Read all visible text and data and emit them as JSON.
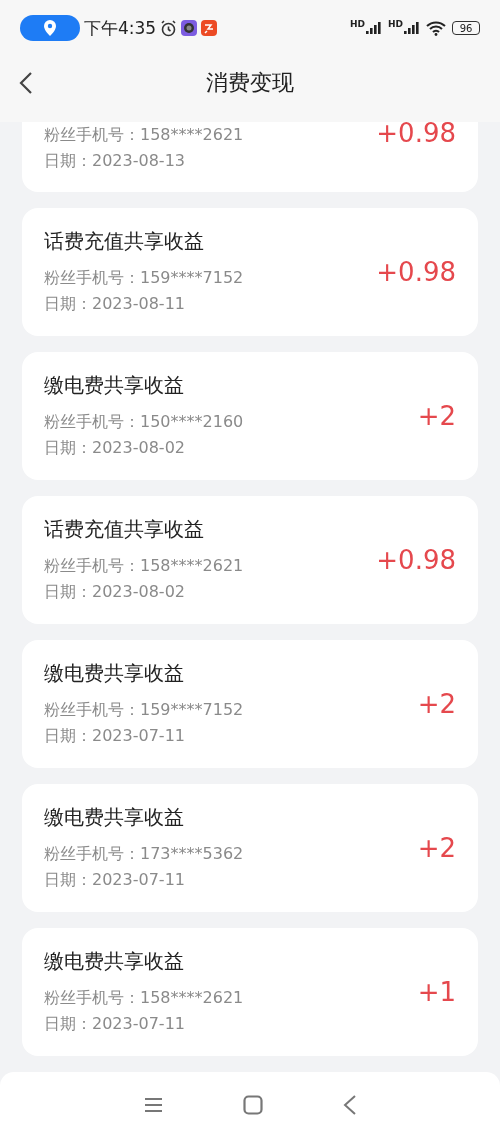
{
  "status_bar": {
    "time": "下午4:35",
    "signal_labels": [
      "HD",
      "HD"
    ],
    "battery": "96"
  },
  "header": {
    "title": "消费变现"
  },
  "records": [
    {
      "kind": "partial",
      "phone_label": "粉丝手机号：",
      "phone": "158****2621",
      "date_label": "日期：",
      "date": "2023-08-13",
      "amount": "+0.98"
    },
    {
      "kind": "full",
      "title": "话费充值共享收益",
      "phone_label": "粉丝手机号：",
      "phone": "159****7152",
      "date_label": "日期：",
      "date": "2023-08-11",
      "amount": "+0.98"
    },
    {
      "kind": "full",
      "title": "缴电费共享收益",
      "phone_label": "粉丝手机号：",
      "phone": "150****2160",
      "date_label": "日期：",
      "date": "2023-08-02",
      "amount": "+2"
    },
    {
      "kind": "full",
      "title": "话费充值共享收益",
      "phone_label": "粉丝手机号：",
      "phone": "158****2621",
      "date_label": "日期：",
      "date": "2023-08-02",
      "amount": "+0.98"
    },
    {
      "kind": "full",
      "title": "缴电费共享收益",
      "phone_label": "粉丝手机号：",
      "phone": "159****7152",
      "date_label": "日期：",
      "date": "2023-07-11",
      "amount": "+2"
    },
    {
      "kind": "full",
      "title": "缴电费共享收益",
      "phone_label": "粉丝手机号：",
      "phone": "173****5362",
      "date_label": "日期：",
      "date": "2023-07-11",
      "amount": "+2"
    },
    {
      "kind": "full",
      "title": "缴电费共享收益",
      "phone_label": "粉丝手机号：",
      "phone": "158****2621",
      "date_label": "日期：",
      "date": "2023-07-11",
      "amount": "+1"
    }
  ]
}
